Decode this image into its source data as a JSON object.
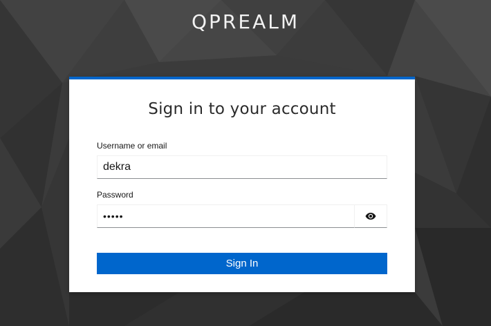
{
  "realm": {
    "title": "QPREALM"
  },
  "login": {
    "heading": "Sign in to your account",
    "username": {
      "label": "Username or email",
      "value": "dekra"
    },
    "password": {
      "label": "Password",
      "value": "•••••"
    },
    "toggle_icon": "eye-icon",
    "sign_in_label": "Sign In"
  },
  "colors": {
    "accent": "#0066cc",
    "background_dark": "#3a3a3a",
    "card": "#ffffff"
  }
}
